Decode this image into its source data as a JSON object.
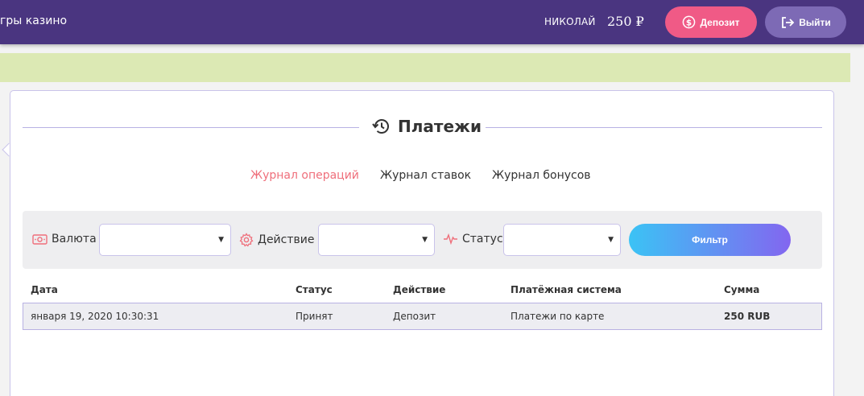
{
  "header": {
    "brand_fragment": "гры казино",
    "username": "НИКОЛАЙ",
    "balance": "250 ₽",
    "deposit_label": "Депозит",
    "logout_label": "Выйти"
  },
  "page": {
    "title": "Платежи",
    "tabs": [
      {
        "label": "Журнал операций",
        "active": true
      },
      {
        "label": "Журнал ставок",
        "active": false
      },
      {
        "label": "Журнал бонусов",
        "active": false
      }
    ]
  },
  "filter": {
    "currency_label": "Валюта",
    "currency_value": "",
    "action_label": "Действие",
    "action_value": "",
    "status_label": "Статус",
    "status_value": "",
    "submit_label": "Фильтр"
  },
  "table": {
    "columns": [
      "Дата",
      "Статус",
      "Действие",
      "Платёжная система",
      "Сумма"
    ],
    "rows": [
      [
        "января 19, 2020 10:30:31",
        "Принят",
        "Депозит",
        "Платежи по карте",
        "250 RUB"
      ]
    ]
  },
  "colors": {
    "header_bg": "#4a3580",
    "deposit_button": "#f05a86",
    "logout_button": "#7d6ab5",
    "active_tab": "#ef6f7b",
    "notice_bar": "#dce9b4",
    "filter_gradient_start": "#3bc3f5",
    "filter_gradient_end": "#8366f0"
  },
  "icons": {
    "deposit": "dollar-circle-icon",
    "logout": "logout-arrow-icon",
    "title": "history-icon",
    "currency": "banknote-icon",
    "action": "gear-icon",
    "status": "pulse-icon"
  }
}
